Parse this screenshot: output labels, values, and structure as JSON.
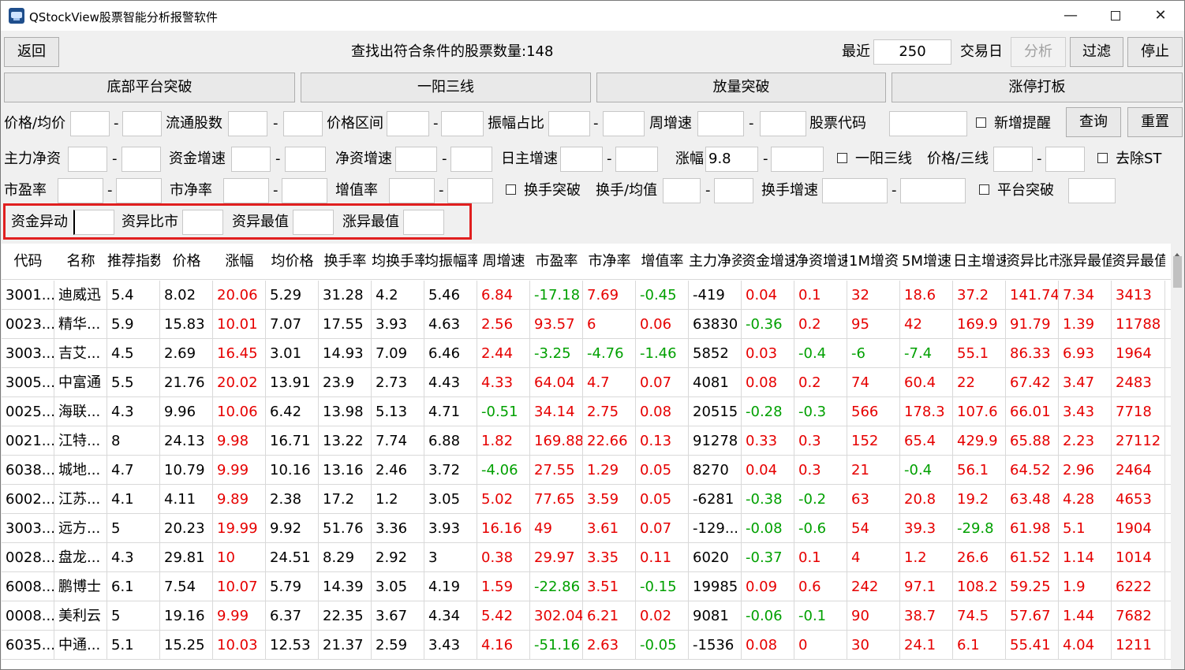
{
  "title": "QStockView股票智能分析报警软件",
  "toolbar": {
    "back": "返回",
    "status": "查找出符合条件的股票数量:148",
    "recent_label": "最近",
    "recent_value": "250",
    "trade_day_label": "交易日",
    "analyze": "分析",
    "filter": "过滤",
    "stop": "停止"
  },
  "strategies": [
    "底部平台突破",
    "一阳三线",
    "放量突破",
    "涨停打板"
  ],
  "filters": {
    "price_avg": "价格/均价",
    "float_shares": "流通股数",
    "price_range": "价格区间",
    "amplitude_ratio": "振幅占比",
    "week_speed": "周增速",
    "stock_code": "股票代码",
    "new_alert": "新增提醒",
    "query": "查询",
    "reset": "重置",
    "main_net": "主力净资",
    "fund_speed": "资金增速",
    "net_speed": "净资增速",
    "day_main_speed": "日主增速",
    "change": "涨幅",
    "change_min": "9.8",
    "one_yang": "一阳三线",
    "price_three": "价格/三线",
    "remove_st": "去除ST",
    "pe": "市盈率",
    "pb": "市净率",
    "growth": "增值率",
    "turnover_break": "换手突破",
    "turnover_avg": "换手/均值",
    "turnover_speed": "换手增速",
    "platform_break": "平台突破",
    "fund_anomaly": "资金异动",
    "fund_ratio": "资异比市",
    "fund_max": "资异最值",
    "change_max": "涨异最值"
  },
  "table": {
    "headers": [
      "代码",
      "名称",
      "推荐指数",
      "价格",
      "涨幅",
      "均价格",
      "换手率",
      "均换手率",
      "均振幅率",
      "周增速",
      "市盈率",
      "市净率",
      "增值率",
      "主力净资",
      "资金增速",
      "净资增速",
      "1M增资",
      "5M增速",
      "日主增速",
      "资异比市",
      "涨异最值",
      "资异最值"
    ],
    "rows": [
      [
        "3001...",
        "迪威迅",
        "5.4",
        "8.02",
        "20.06",
        "5.29",
        "31.28",
        "4.2",
        "5.46",
        "6.84",
        "-17.18",
        "7.69",
        "-0.45",
        "-419",
        "0.04",
        "0.1",
        "32",
        "18.6",
        "37.2",
        "141.74",
        "7.34",
        "3413"
      ],
      [
        "0023...",
        "精华...",
        "5.9",
        "15.83",
        "10.01",
        "7.07",
        "17.55",
        "3.93",
        "4.63",
        "2.56",
        "93.57",
        "6",
        "0.06",
        "63830",
        "-0.36",
        "0.2",
        "95",
        "42",
        "169.9",
        "91.79",
        "1.39",
        "11788"
      ],
      [
        "3003...",
        "吉艾...",
        "4.5",
        "2.69",
        "16.45",
        "3.01",
        "14.93",
        "7.09",
        "6.46",
        "2.44",
        "-3.25",
        "-4.76",
        "-1.46",
        "5852",
        "0.03",
        "-0.4",
        "-6",
        "-7.4",
        "55.1",
        "86.33",
        "6.93",
        "1964"
      ],
      [
        "3005...",
        "中富通",
        "5.5",
        "21.76",
        "20.02",
        "13.91",
        "23.9",
        "2.73",
        "4.43",
        "4.33",
        "64.04",
        "4.7",
        "0.07",
        "4081",
        "0.08",
        "0.2",
        "74",
        "60.4",
        "22",
        "67.42",
        "3.47",
        "2483"
      ],
      [
        "0025...",
        "海联...",
        "4.3",
        "9.96",
        "10.06",
        "6.42",
        "13.98",
        "5.13",
        "4.71",
        "-0.51",
        "34.14",
        "2.75",
        "0.08",
        "20515",
        "-0.28",
        "-0.3",
        "566",
        "178.3",
        "107.6",
        "66.01",
        "3.43",
        "7718"
      ],
      [
        "0021...",
        "江特...",
        "8",
        "24.13",
        "9.98",
        "16.71",
        "13.22",
        "7.74",
        "6.88",
        "1.82",
        "169.88",
        "22.66",
        "0.13",
        "91278",
        "0.33",
        "0.3",
        "152",
        "65.4",
        "429.9",
        "65.88",
        "2.23",
        "27112"
      ],
      [
        "6038...",
        "城地...",
        "4.7",
        "10.79",
        "9.99",
        "10.16",
        "13.16",
        "2.46",
        "3.72",
        "-4.06",
        "27.55",
        "1.29",
        "0.05",
        "8270",
        "0.04",
        "0.3",
        "21",
        "-0.4",
        "56.1",
        "64.52",
        "2.96",
        "2464"
      ],
      [
        "6002...",
        "江苏...",
        "4.1",
        "4.11",
        "9.89",
        "2.38",
        "17.2",
        "1.2",
        "3.05",
        "5.02",
        "77.65",
        "3.59",
        "0.05",
        "-6281",
        "-0.38",
        "-0.2",
        "63",
        "20.8",
        "19.2",
        "63.48",
        "4.28",
        "4653"
      ],
      [
        "3003...",
        "远方...",
        "5",
        "20.23",
        "19.99",
        "9.92",
        "51.76",
        "3.36",
        "3.93",
        "16.16",
        "49",
        "3.61",
        "0.07",
        "-129...",
        "-0.08",
        "-0.6",
        "54",
        "39.3",
        "-29.8",
        "61.98",
        "5.1",
        "1904"
      ],
      [
        "0028...",
        "盘龙...",
        "4.3",
        "29.81",
        "10",
        "24.51",
        "8.29",
        "2.92",
        "3",
        "0.38",
        "29.97",
        "3.35",
        "0.11",
        "6020",
        "-0.37",
        "0.1",
        "4",
        "1.2",
        "26.6",
        "61.52",
        "1.14",
        "1014"
      ],
      [
        "6008...",
        "鹏博士",
        "6.1",
        "7.54",
        "10.07",
        "5.79",
        "14.39",
        "3.05",
        "4.19",
        "1.59",
        "-22.86",
        "3.51",
        "-0.15",
        "19985",
        "0.09",
        "0.6",
        "242",
        "97.1",
        "108.2",
        "59.25",
        "1.9",
        "6222"
      ],
      [
        "0008...",
        "美利云",
        "5",
        "19.16",
        "9.99",
        "6.37",
        "22.35",
        "3.67",
        "4.34",
        "5.42",
        "302.04",
        "6.21",
        "0.02",
        "9081",
        "-0.06",
        "-0.1",
        "90",
        "38.7",
        "74.5",
        "57.67",
        "1.44",
        "7682"
      ],
      [
        "6035...",
        "中通...",
        "5.1",
        "15.25",
        "10.03",
        "12.53",
        "21.37",
        "2.59",
        "3.43",
        "4.16",
        "-51.16",
        "2.63",
        "-0.05",
        "-1536",
        "0.08",
        "0",
        "30",
        "24.1",
        "6.1",
        "55.41",
        "4.04",
        "1211"
      ]
    ]
  }
}
